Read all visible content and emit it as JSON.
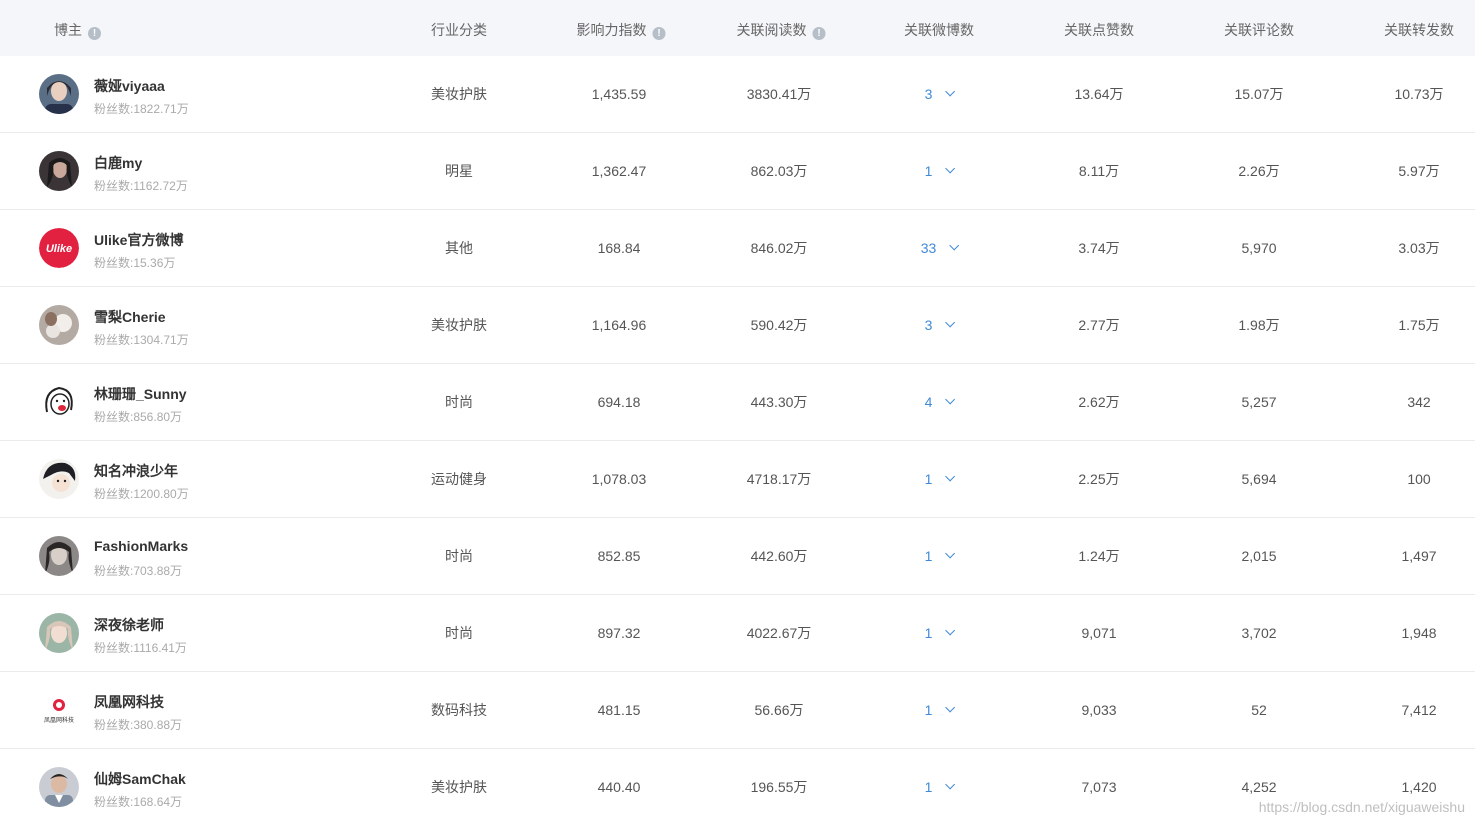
{
  "columns": {
    "blogger": "博主",
    "industry": "行业分类",
    "influence": "影响力指数",
    "reads": "关联阅读数",
    "weibo": "关联微博数",
    "likes": "关联点赞数",
    "comments": "关联评论数",
    "reposts": "关联转发数"
  },
  "info_glyph": "!",
  "rows": [
    {
      "name": "薇娅viyaaa",
      "fans": "粉丝数:1822.71万",
      "industry": "美妆护肤",
      "influence": "1,435.59",
      "reads": "3830.41万",
      "weibo": "3",
      "likes": "13.64万",
      "comments": "15.07万",
      "reposts": "10.73万"
    },
    {
      "name": "白鹿my",
      "fans": "粉丝数:1162.72万",
      "industry": "明星",
      "influence": "1,362.47",
      "reads": "862.03万",
      "weibo": "1",
      "likes": "8.11万",
      "comments": "2.26万",
      "reposts": "5.97万"
    },
    {
      "name": "Ulike官方微博",
      "fans": "粉丝数:15.36万",
      "industry": "其他",
      "influence": "168.84",
      "reads": "846.02万",
      "weibo": "33",
      "likes": "3.74万",
      "comments": "5,970",
      "reposts": "3.03万"
    },
    {
      "name": "雪梨Cherie",
      "fans": "粉丝数:1304.71万",
      "industry": "美妆护肤",
      "influence": "1,164.96",
      "reads": "590.42万",
      "weibo": "3",
      "likes": "2.77万",
      "comments": "1.98万",
      "reposts": "1.75万"
    },
    {
      "name": "林珊珊_Sunny",
      "fans": "粉丝数:856.80万",
      "industry": "时尚",
      "influence": "694.18",
      "reads": "443.30万",
      "weibo": "4",
      "likes": "2.62万",
      "comments": "5,257",
      "reposts": "342"
    },
    {
      "name": "知名冲浪少年",
      "fans": "粉丝数:1200.80万",
      "industry": "运动健身",
      "influence": "1,078.03",
      "reads": "4718.17万",
      "weibo": "1",
      "likes": "2.25万",
      "comments": "5,694",
      "reposts": "100"
    },
    {
      "name": "FashionMarks",
      "fans": "粉丝数:703.88万",
      "industry": "时尚",
      "influence": "852.85",
      "reads": "442.60万",
      "weibo": "1",
      "likes": "1.24万",
      "comments": "2,015",
      "reposts": "1,497"
    },
    {
      "name": "深夜徐老师",
      "fans": "粉丝数:1116.41万",
      "industry": "时尚",
      "influence": "897.32",
      "reads": "4022.67万",
      "weibo": "1",
      "likes": "9,071",
      "comments": "3,702",
      "reposts": "1,948"
    },
    {
      "name": "凤凰网科技",
      "fans": "粉丝数:380.88万",
      "industry": "数码科技",
      "influence": "481.15",
      "reads": "56.66万",
      "weibo": "1",
      "likes": "9,033",
      "comments": "52",
      "reposts": "7,412"
    },
    {
      "name": "仙姆SamChak",
      "fans": "粉丝数:168.64万",
      "industry": "美妆护肤",
      "influence": "440.40",
      "reads": "196.55万",
      "weibo": "1",
      "likes": "7,073",
      "comments": "4,252",
      "reposts": "1,420"
    }
  ],
  "avatars": {
    "ulike_logo_text": "Ulike",
    "ifeng_logo_text": "凤凰网科技",
    "ulike_color": "#e2203f"
  },
  "watermark": "https://blog.csdn.net/xiguaweishu",
  "colors": {
    "header_bg": "#f4f6f9",
    "link_blue": "#3f8ad8"
  }
}
